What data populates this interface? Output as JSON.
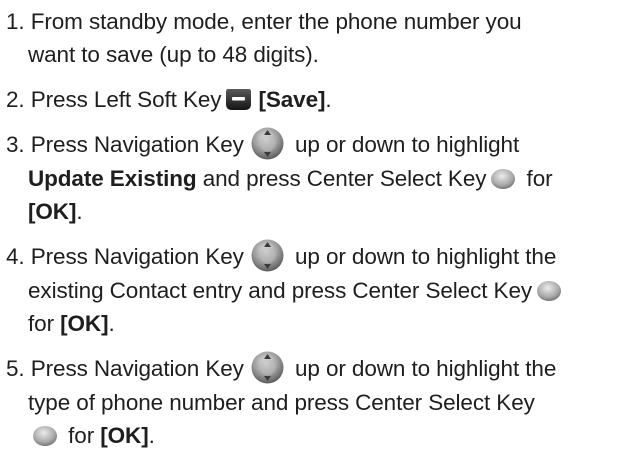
{
  "steps": [
    {
      "num": "1.",
      "line1": "From standby mode, enter the phone number you",
      "line2": "want to save (up to 48 digits)."
    },
    {
      "num": "2.",
      "pre": "Press Left Soft Key",
      "key": "[Save]",
      "post": ".",
      "icon": "left-soft-key-icon"
    },
    {
      "num": "3.",
      "pre": "Press Navigation Key",
      "mid": "up or down to highlight",
      "bold1": "Update Existing",
      "mid2": "and press Center Select Key",
      "post2": "for",
      "key": "[OK]",
      "end": ".",
      "icons": [
        "navigation-key-icon",
        "center-select-key-icon"
      ]
    },
    {
      "num": "4.",
      "pre": "Press Navigation Key",
      "mid": "up or down to highlight the",
      "line2": "existing Contact entry and press Center Select Key",
      "pre3": "for",
      "key": "[OK]",
      "end": ".",
      "icons": [
        "navigation-key-icon",
        "center-select-key-icon"
      ]
    },
    {
      "num": "5.",
      "pre": "Press Navigation Key",
      "mid": "up or down to highlight the",
      "line2": "type of phone number and press Center Select Key",
      "pre3": "for",
      "key": "[OK]",
      "end": ".",
      "icons": [
        "navigation-key-icon",
        "center-select-key-icon"
      ]
    }
  ]
}
